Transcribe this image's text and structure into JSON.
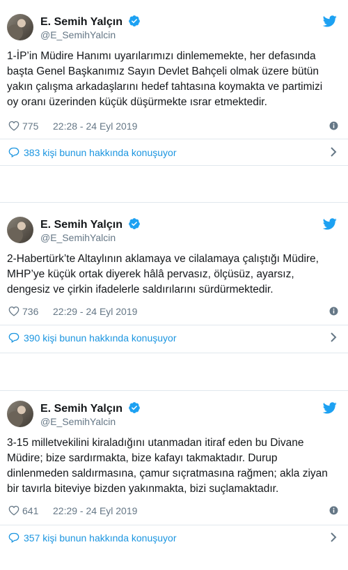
{
  "tweets": [
    {
      "author": "E. Semih Yalçın",
      "handle": "@E_SemihYalcin",
      "text": "1-İP’in Müdire Hanımı uyarılarımızı dinlememekte, her defasında\nbaşta Genel Başkanımız Sayın Devlet Bahçeli olmak üzere bütün\nyakın çalışma arkadaşlarını hedef tahtasına koymakta ve partimizi\noy oranı üzerinden küçük düşürmekte ısrar etmektedir.",
      "likes": "775",
      "timestamp": "22:28 - 24 Eyl 2019",
      "replies": "383 kişi bunun hakkında konuşuyor"
    },
    {
      "author": "E. Semih Yalçın",
      "handle": "@E_SemihYalcin",
      "text": "2-Habertürk’te Altaylının aklamaya ve cilalamaya çalıştığı Müdire,\nMHP’ye küçük ortak diyerek hâlâ pervasız, ölçüsüz, ayarsız,\ndengesiz ve çirkin ifadelerle saldırılarını sürdürmektedir.",
      "likes": "736",
      "timestamp": "22:29 - 24 Eyl 2019",
      "replies": "390 kişi bunun hakkında konuşuyor"
    },
    {
      "author": "E. Semih Yalçın",
      "handle": "@E_SemihYalcin",
      "text": "3-15 milletvekilini kiraladığını utanmadan itiraf eden bu Divane\nMüdire; bize sardırmakta, bize kafayı takmaktadır. Durup\ndinlenmeden saldırmasına, çamur sıçratmasına rağmen; akla ziyan\nbir tavırla biteviye bizden yakınmakta, bizi suçlamaktadır.",
      "likes": "641",
      "timestamp": "22:29 - 24 Eyl 2019",
      "replies": "357 kişi bunun hakkında konuşuyor"
    }
  ],
  "colors": {
    "accent": "#1da1f2",
    "link": "#1b95e0",
    "muted": "#657786",
    "border": "#e1e8ed"
  },
  "icons": [
    "verified-badge-icon",
    "twitter-bird-icon",
    "heart-icon",
    "info-icon",
    "reply-bubble-icon",
    "chevron-right-icon"
  ]
}
